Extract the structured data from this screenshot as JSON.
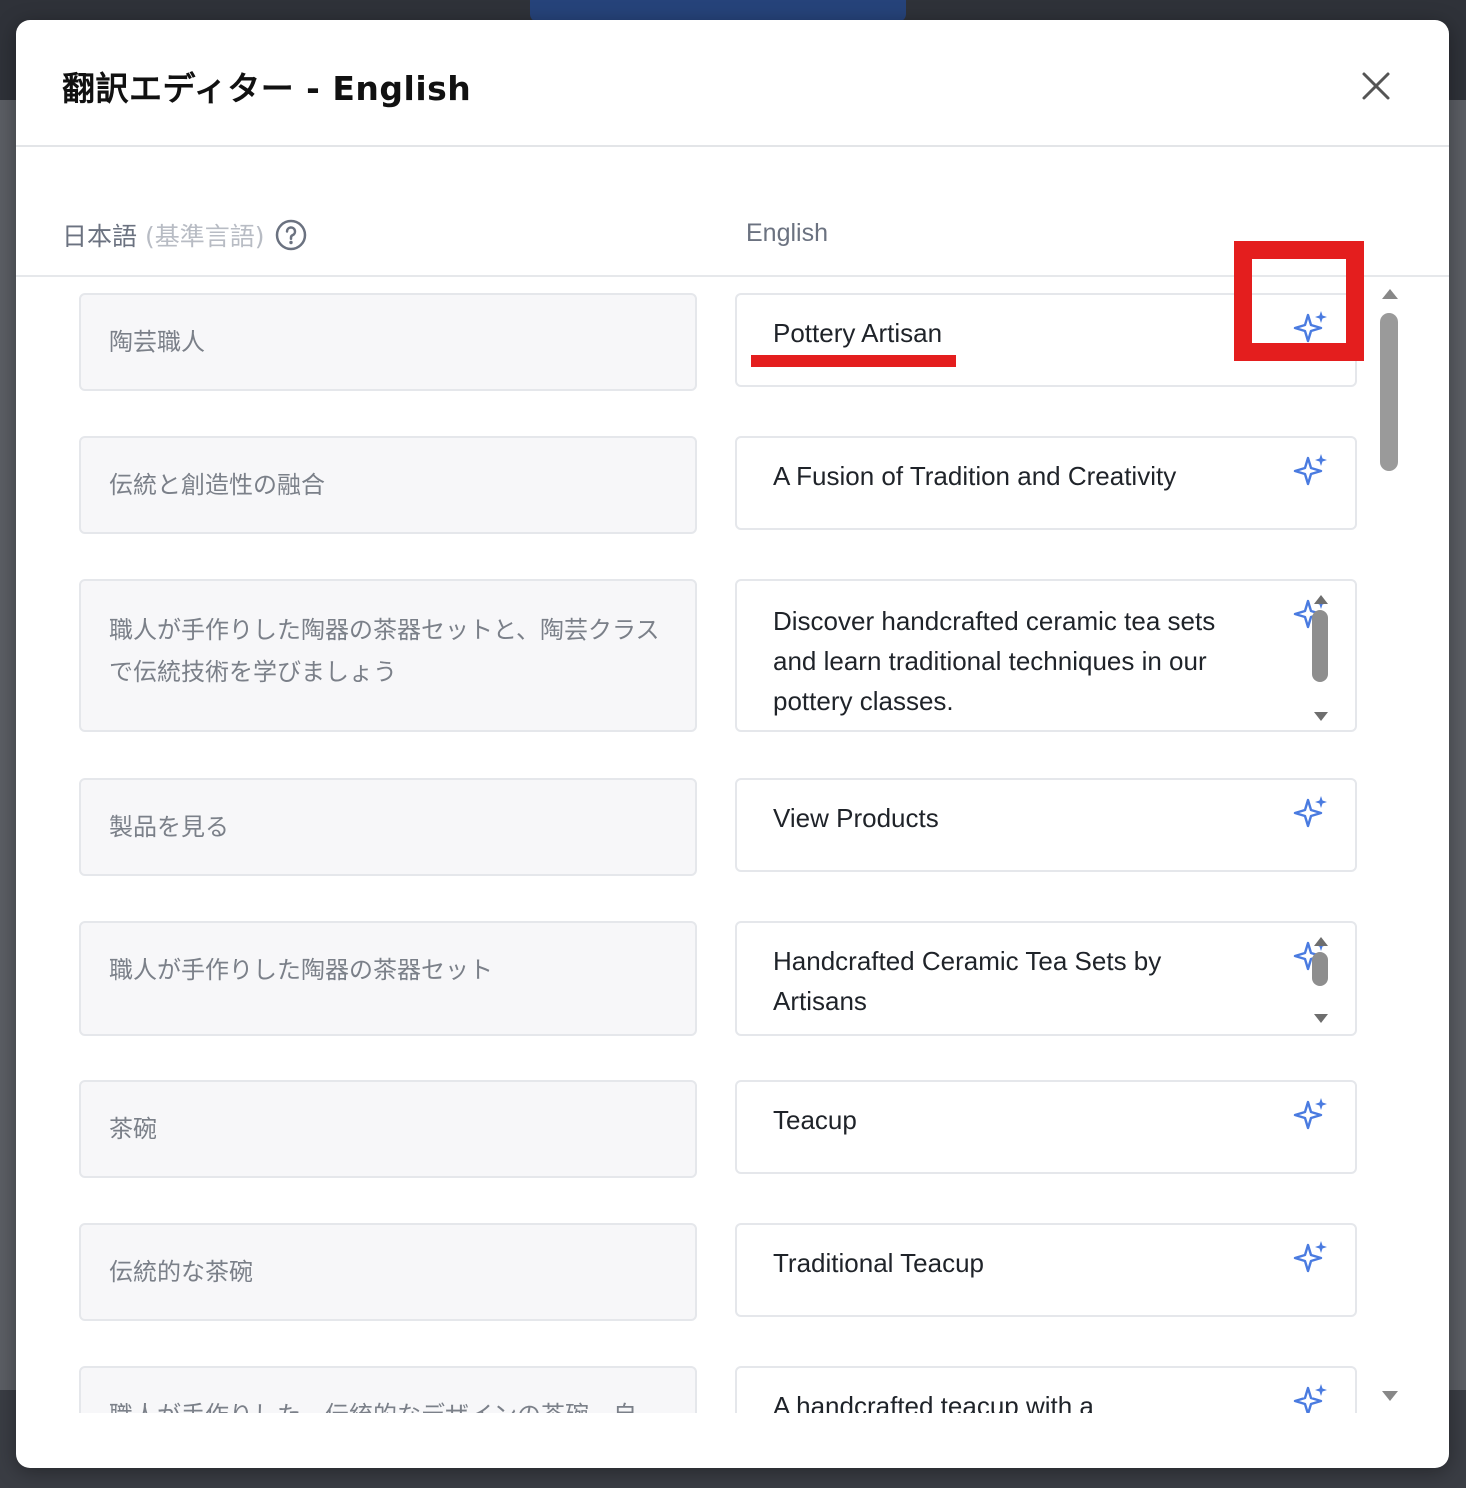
{
  "modal": {
    "title": "翻訳エディター - English",
    "columns": {
      "source_label": "日本語",
      "source_note": "(基準言語)",
      "target_label": "English"
    }
  },
  "rows": [
    {
      "source": "陶芸職人",
      "target": "Pottery Artisan"
    },
    {
      "source": "伝統と創造性の融合",
      "target": "A Fusion of Tradition and Creativity"
    },
    {
      "source": "職人が手作りした陶器の茶器セットと、陶芸クラスで伝統技術を学びましょう",
      "target": "Discover handcrafted ceramic tea sets and learn traditional techniques in our pottery classes."
    },
    {
      "source": "製品を見る",
      "target": "View Products"
    },
    {
      "source": "職人が手作りした陶器の茶器セット",
      "target": "Handcrafted Ceramic Tea Sets by Artisans"
    },
    {
      "source": "茶碗",
      "target": "Teacup"
    },
    {
      "source": "伝統的な茶碗",
      "target": "Traditional Teacup"
    },
    {
      "source": "職人が手作りした、伝統的なデザインの茶碗。自",
      "target": "A handcrafted teacup with a"
    }
  ],
  "colors": {
    "accent_blue": "#4a7be0",
    "annotation_red": "#e41e1e"
  },
  "icons": {
    "close": "close-icon",
    "help": "help-circle-icon",
    "ai_translate": "sparkle-icon"
  }
}
